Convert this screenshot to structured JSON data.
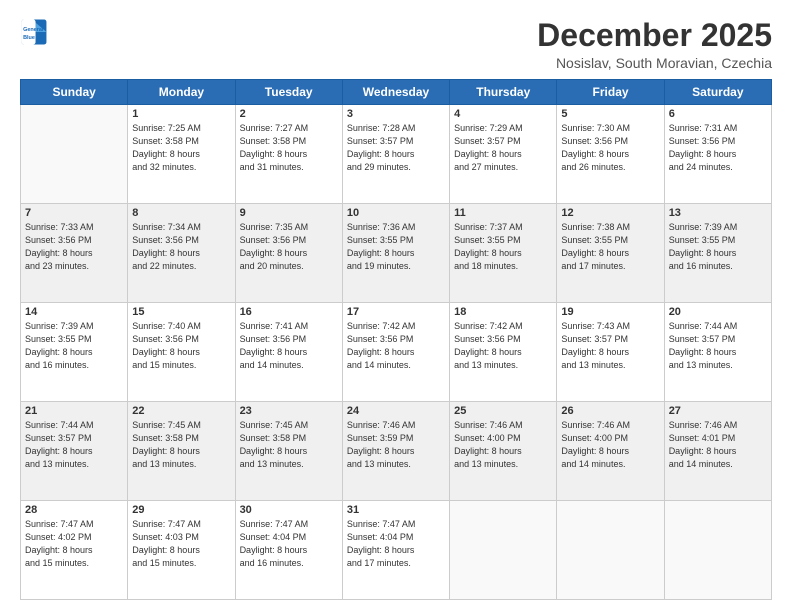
{
  "logo": {
    "line1": "General",
    "line2": "Blue"
  },
  "title": "December 2025",
  "subtitle": "Nosislav, South Moravian, Czechia",
  "headers": [
    "Sunday",
    "Monday",
    "Tuesday",
    "Wednesday",
    "Thursday",
    "Friday",
    "Saturday"
  ],
  "weeks": [
    [
      {
        "day": "",
        "info": ""
      },
      {
        "day": "1",
        "info": "Sunrise: 7:25 AM\nSunset: 3:58 PM\nDaylight: 8 hours\nand 32 minutes."
      },
      {
        "day": "2",
        "info": "Sunrise: 7:27 AM\nSunset: 3:58 PM\nDaylight: 8 hours\nand 31 minutes."
      },
      {
        "day": "3",
        "info": "Sunrise: 7:28 AM\nSunset: 3:57 PM\nDaylight: 8 hours\nand 29 minutes."
      },
      {
        "day": "4",
        "info": "Sunrise: 7:29 AM\nSunset: 3:57 PM\nDaylight: 8 hours\nand 27 minutes."
      },
      {
        "day": "5",
        "info": "Sunrise: 7:30 AM\nSunset: 3:56 PM\nDaylight: 8 hours\nand 26 minutes."
      },
      {
        "day": "6",
        "info": "Sunrise: 7:31 AM\nSunset: 3:56 PM\nDaylight: 8 hours\nand 24 minutes."
      }
    ],
    [
      {
        "day": "7",
        "info": "Sunrise: 7:33 AM\nSunset: 3:56 PM\nDaylight: 8 hours\nand 23 minutes."
      },
      {
        "day": "8",
        "info": "Sunrise: 7:34 AM\nSunset: 3:56 PM\nDaylight: 8 hours\nand 22 minutes."
      },
      {
        "day": "9",
        "info": "Sunrise: 7:35 AM\nSunset: 3:56 PM\nDaylight: 8 hours\nand 20 minutes."
      },
      {
        "day": "10",
        "info": "Sunrise: 7:36 AM\nSunset: 3:55 PM\nDaylight: 8 hours\nand 19 minutes."
      },
      {
        "day": "11",
        "info": "Sunrise: 7:37 AM\nSunset: 3:55 PM\nDaylight: 8 hours\nand 18 minutes."
      },
      {
        "day": "12",
        "info": "Sunrise: 7:38 AM\nSunset: 3:55 PM\nDaylight: 8 hours\nand 17 minutes."
      },
      {
        "day": "13",
        "info": "Sunrise: 7:39 AM\nSunset: 3:55 PM\nDaylight: 8 hours\nand 16 minutes."
      }
    ],
    [
      {
        "day": "14",
        "info": "Sunrise: 7:39 AM\nSunset: 3:55 PM\nDaylight: 8 hours\nand 16 minutes."
      },
      {
        "day": "15",
        "info": "Sunrise: 7:40 AM\nSunset: 3:56 PM\nDaylight: 8 hours\nand 15 minutes."
      },
      {
        "day": "16",
        "info": "Sunrise: 7:41 AM\nSunset: 3:56 PM\nDaylight: 8 hours\nand 14 minutes."
      },
      {
        "day": "17",
        "info": "Sunrise: 7:42 AM\nSunset: 3:56 PM\nDaylight: 8 hours\nand 14 minutes."
      },
      {
        "day": "18",
        "info": "Sunrise: 7:42 AM\nSunset: 3:56 PM\nDaylight: 8 hours\nand 13 minutes."
      },
      {
        "day": "19",
        "info": "Sunrise: 7:43 AM\nSunset: 3:57 PM\nDaylight: 8 hours\nand 13 minutes."
      },
      {
        "day": "20",
        "info": "Sunrise: 7:44 AM\nSunset: 3:57 PM\nDaylight: 8 hours\nand 13 minutes."
      }
    ],
    [
      {
        "day": "21",
        "info": "Sunrise: 7:44 AM\nSunset: 3:57 PM\nDaylight: 8 hours\nand 13 minutes."
      },
      {
        "day": "22",
        "info": "Sunrise: 7:45 AM\nSunset: 3:58 PM\nDaylight: 8 hours\nand 13 minutes."
      },
      {
        "day": "23",
        "info": "Sunrise: 7:45 AM\nSunset: 3:58 PM\nDaylight: 8 hours\nand 13 minutes."
      },
      {
        "day": "24",
        "info": "Sunrise: 7:46 AM\nSunset: 3:59 PM\nDaylight: 8 hours\nand 13 minutes."
      },
      {
        "day": "25",
        "info": "Sunrise: 7:46 AM\nSunset: 4:00 PM\nDaylight: 8 hours\nand 13 minutes."
      },
      {
        "day": "26",
        "info": "Sunrise: 7:46 AM\nSunset: 4:00 PM\nDaylight: 8 hours\nand 14 minutes."
      },
      {
        "day": "27",
        "info": "Sunrise: 7:46 AM\nSunset: 4:01 PM\nDaylight: 8 hours\nand 14 minutes."
      }
    ],
    [
      {
        "day": "28",
        "info": "Sunrise: 7:47 AM\nSunset: 4:02 PM\nDaylight: 8 hours\nand 15 minutes."
      },
      {
        "day": "29",
        "info": "Sunrise: 7:47 AM\nSunset: 4:03 PM\nDaylight: 8 hours\nand 15 minutes."
      },
      {
        "day": "30",
        "info": "Sunrise: 7:47 AM\nSunset: 4:04 PM\nDaylight: 8 hours\nand 16 minutes."
      },
      {
        "day": "31",
        "info": "Sunrise: 7:47 AM\nSunset: 4:04 PM\nDaylight: 8 hours\nand 17 minutes."
      },
      {
        "day": "",
        "info": ""
      },
      {
        "day": "",
        "info": ""
      },
      {
        "day": "",
        "info": ""
      }
    ]
  ]
}
